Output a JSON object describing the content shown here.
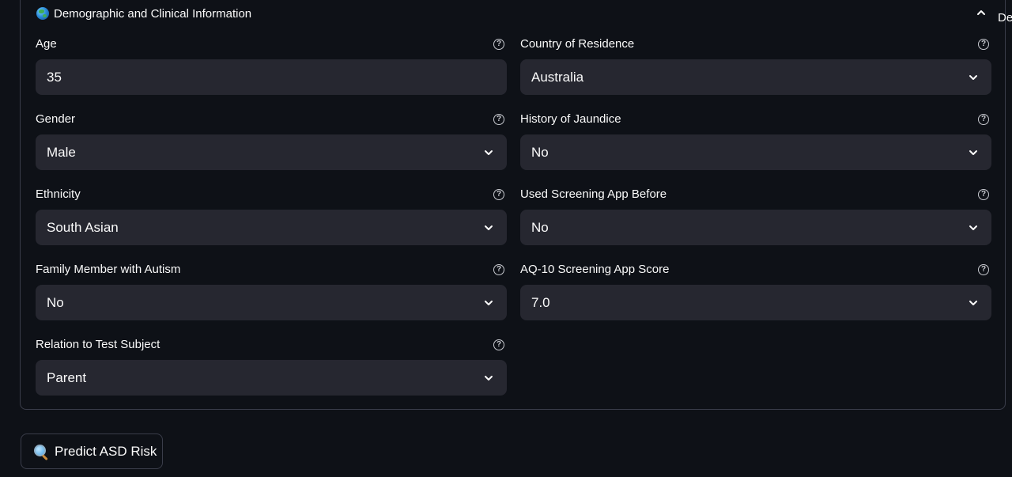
{
  "expander": {
    "title": "Demographic and Clinical Information",
    "cut_text": "De"
  },
  "fields": {
    "age": {
      "label": "Age",
      "value": "35"
    },
    "country": {
      "label": "Country of Residence",
      "value": "Australia"
    },
    "gender": {
      "label": "Gender",
      "value": "Male"
    },
    "jaundice": {
      "label": "History of Jaundice",
      "value": "No"
    },
    "ethnicity": {
      "label": "Ethnicity",
      "value": "South Asian"
    },
    "used_app": {
      "label": "Used Screening App Before",
      "value": "No"
    },
    "family_autism": {
      "label": "Family Member with Autism",
      "value": "No"
    },
    "aq10": {
      "label": "AQ-10 Screening App Score",
      "value": "7.0"
    },
    "relation": {
      "label": "Relation to Test Subject",
      "value": "Parent"
    }
  },
  "predict_button": {
    "label": "Predict ASD Risk"
  },
  "icons": {
    "expander": "globe-icon",
    "button": "magnifier-icon",
    "help": "question-circle-icon",
    "select": "chevron-down-icon"
  }
}
